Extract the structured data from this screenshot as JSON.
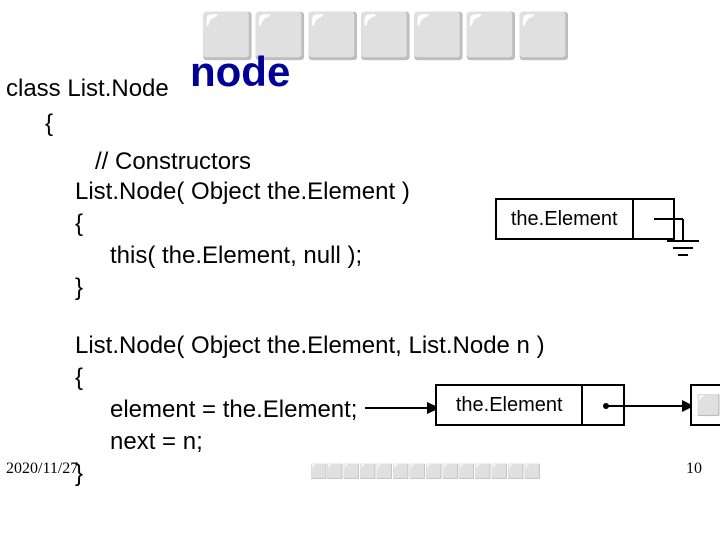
{
  "title": {
    "glyphs": "⬜⬜⬜⬜⬜⬜⬜",
    "word": "node"
  },
  "code": {
    "class_decl": "class List.Node",
    "brace_open": "{",
    "comment": "// Constructors",
    "ctor1_sig": "List.Node( Object the.Element )",
    "ctor1_open": "{",
    "ctor1_body": "this( the.Element, null );",
    "ctor1_close": "}",
    "ctor2_sig": "List.Node( Object the.Element, List.Node n )",
    "ctor2_open": "{",
    "ctor2_body1": "element = the.Element;",
    "ctor2_body2": "next    = n;",
    "ctor2_close": "}"
  },
  "boxes": {
    "box1_label": "the.Element",
    "box2_label": "the.Element",
    "box3_glyphs": "⬜⬜⬜"
  },
  "footer": {
    "date": "2020/11/27",
    "glyphs": "⬜⬜⬜⬜⬜⬜⬜⬜⬜⬜⬜⬜⬜⬜",
    "page": "10"
  }
}
